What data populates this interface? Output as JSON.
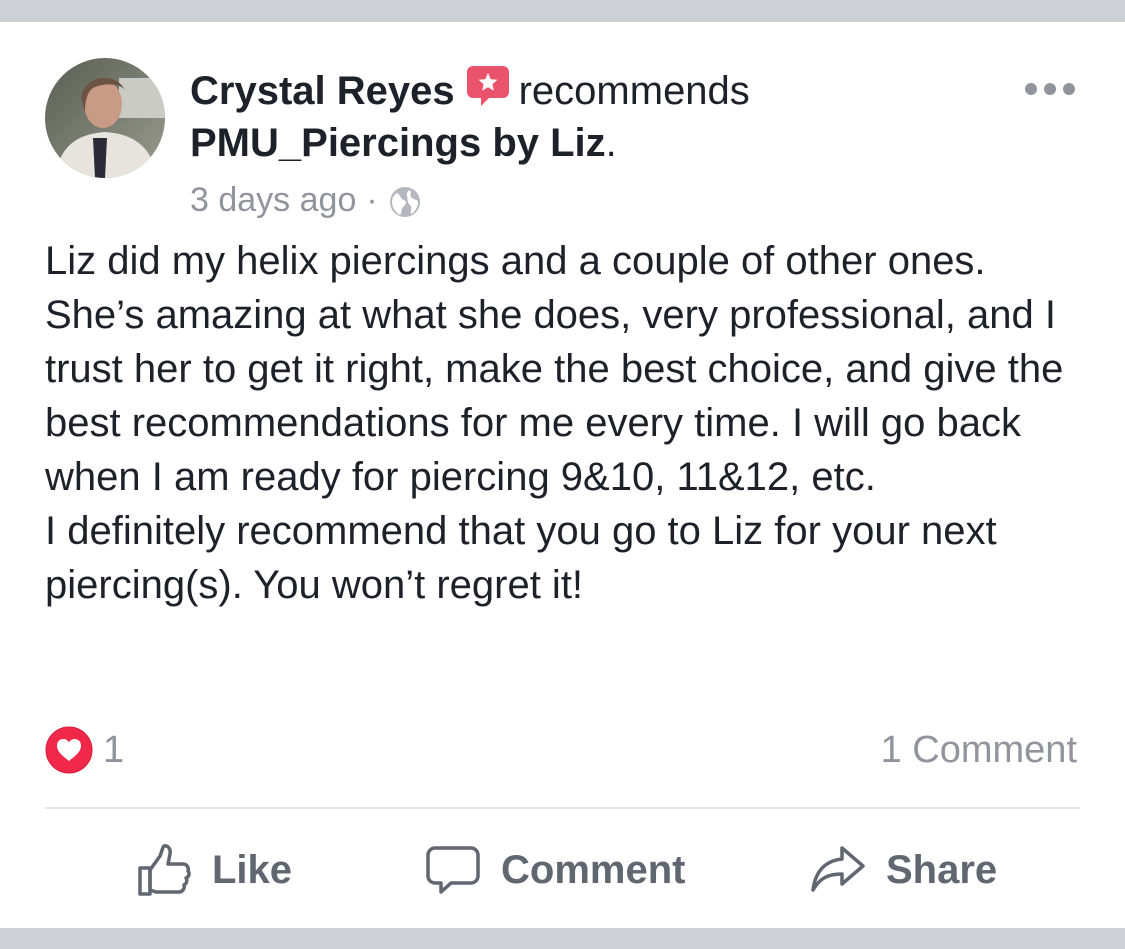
{
  "post": {
    "author": "Crystal Reyes",
    "verb": "recommends",
    "page_name": "PMU_Piercings by Liz",
    "page_suffix": ".",
    "timestamp": "3 days ago",
    "separator": "·",
    "privacy_icon": "globe-icon",
    "badge_icon": "recommendation-star-icon",
    "more_icon": "more-dots-icon",
    "body_paragraphs": [
      "Liz did my helix piercings and a couple of other ones. She’s amazing at what she does, very professional, and I trust her to get it right, make the best choice, and give the best recommendations for me every time. I will go back when I am ready for piercing 9&10, 11&12, etc.",
      "I definitely recommend that you go to Liz for your next piercing(s). You won’t regret it!"
    ]
  },
  "stats": {
    "reaction_icon": "love-icon",
    "reaction_count": "1",
    "comment_count_label": "1 Comment"
  },
  "actions": {
    "like_label": "Like",
    "comment_label": "Comment",
    "share_label": "Share"
  },
  "colors": {
    "text": "#1d2129",
    "muted": "#90949c",
    "action": "#606770",
    "badge": "#e9536b",
    "love": "#f0284a",
    "bars": "#cdd0d5"
  }
}
